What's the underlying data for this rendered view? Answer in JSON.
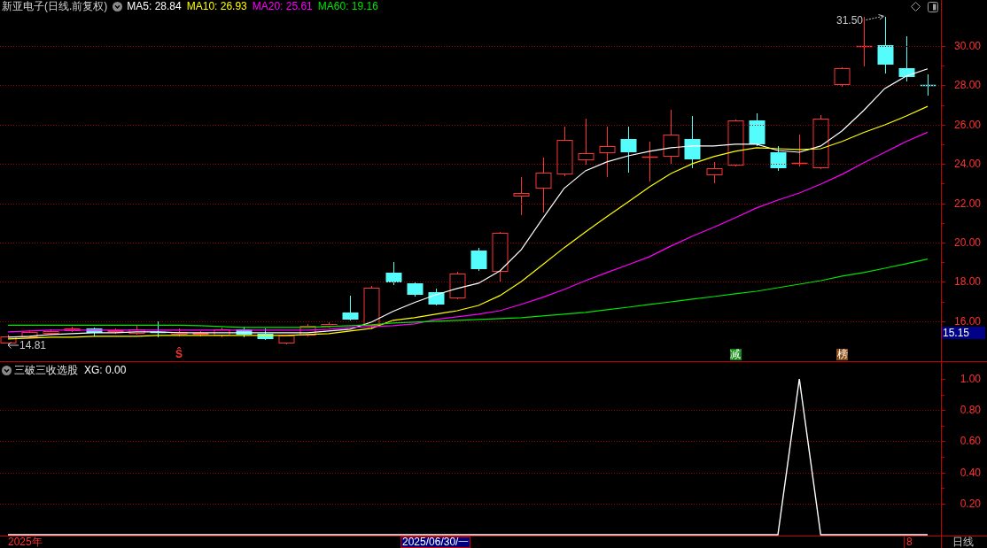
{
  "price_panel": {
    "title": "新亚电子(日线.前复权)",
    "high_marker": "31.50",
    "low_marker": "14.81",
    "signals": [
      {
        "kind": "arrow",
        "text": "Ŝ",
        "color": "#ff3232"
      },
      {
        "kind": "tag",
        "text": "减",
        "color": "#118811"
      },
      {
        "kind": "tag",
        "text": "榜",
        "color": "#8b4a12"
      }
    ],
    "price_tag": "15.15",
    "chart_data": {
      "type": "line",
      "grid": true,
      "ylim": [
        13.96,
        32.34
      ],
      "yticks": [
        {
          "value": 30,
          "label": "30.00"
        },
        {
          "value": 28,
          "label": "28.00"
        },
        {
          "value": 26,
          "label": "26.00"
        },
        {
          "value": 24,
          "label": "24.00"
        },
        {
          "value": 22,
          "label": "22.00"
        },
        {
          "value": 20,
          "label": "20.00"
        },
        {
          "value": 18,
          "label": "18.00"
        },
        {
          "value": 16,
          "label": "16.00"
        }
      ],
      "series": [
        {
          "name": "MA5: 28.84",
          "color": "#ffffff",
          "values": [
            15.18,
            15.23,
            15.32,
            15.36,
            15.41,
            15.41,
            15.45,
            15.45,
            15.41,
            15.41,
            15.41,
            15.41,
            15.41,
            15.41,
            15.41,
            15.5,
            15.59,
            15.95,
            16.49,
            16.94,
            17.34,
            17.66,
            17.93,
            18.56,
            19.64,
            21.22,
            22.75,
            23.65,
            24.1,
            24.41,
            24.64,
            24.82,
            24.91,
            24.91,
            25.0,
            25.0,
            24.68,
            24.59,
            24.91,
            25.68,
            26.71,
            27.84,
            28.47,
            28.84
          ]
        },
        {
          "name": "MA10: 26.93",
          "color": "#ffff00",
          "values": [
            15.09,
            15.14,
            15.18,
            15.18,
            15.23,
            15.23,
            15.23,
            15.27,
            15.27,
            15.27,
            15.27,
            15.27,
            15.27,
            15.27,
            15.32,
            15.36,
            15.5,
            15.63,
            16.04,
            16.17,
            16.35,
            16.53,
            16.8,
            17.3,
            18.02,
            18.87,
            19.73,
            20.54,
            21.31,
            22.07,
            22.84,
            23.51,
            24.01,
            24.37,
            24.64,
            24.82,
            24.77,
            24.73,
            24.77,
            25.14,
            25.59,
            25.99,
            26.44,
            26.93
          ]
        },
        {
          "name": "MA20: 25.61",
          "color": "#ff00ff",
          "values": [
            15.45,
            15.5,
            15.54,
            15.54,
            15.54,
            15.54,
            15.54,
            15.54,
            15.54,
            15.54,
            15.54,
            15.54,
            15.54,
            15.54,
            15.54,
            15.59,
            15.68,
            15.72,
            15.77,
            15.86,
            16.08,
            16.22,
            16.35,
            16.53,
            16.85,
            17.21,
            17.61,
            18.06,
            18.47,
            18.87,
            19.28,
            19.82,
            20.32,
            20.77,
            21.26,
            21.76,
            22.16,
            22.52,
            22.97,
            23.47,
            24.05,
            24.59,
            25.14,
            25.61
          ]
        },
        {
          "name": "MA60: 19.16",
          "color": "#00e600",
          "values": [
            15.79,
            15.79,
            15.79,
            15.79,
            15.79,
            15.79,
            15.79,
            15.79,
            15.79,
            15.77,
            15.72,
            15.68,
            15.68,
            15.68,
            15.68,
            15.72,
            15.77,
            15.81,
            15.9,
            15.95,
            15.99,
            16.04,
            16.08,
            16.13,
            16.17,
            16.26,
            16.35,
            16.44,
            16.58,
            16.71,
            16.85,
            16.98,
            17.12,
            17.25,
            17.39,
            17.52,
            17.7,
            17.88,
            18.06,
            18.29,
            18.47,
            18.69,
            18.92,
            19.16
          ]
        }
      ]
    }
  },
  "indicator_panel": {
    "name": "三破三收选股",
    "chart_data": {
      "type": "line",
      "grid": true,
      "ylim": [
        0,
        1.108
      ],
      "yticks": [
        {
          "value": 1,
          "label": "1.00"
        },
        {
          "value": 0.8,
          "label": "0.80"
        },
        {
          "value": 0.6,
          "label": "0.60"
        },
        {
          "value": 0.4,
          "label": "0.40"
        },
        {
          "value": 0.2,
          "label": "0.20"
        }
      ],
      "series": [
        {
          "name": "XG: 0.00",
          "color": "#ffffff",
          "values": [
            0,
            0,
            0,
            0,
            0,
            0,
            0,
            0,
            0,
            0,
            0,
            0,
            0,
            0,
            0,
            0,
            0,
            0,
            0,
            0,
            0,
            0,
            0,
            0,
            0,
            0,
            0,
            0,
            0,
            0,
            0,
            0,
            0,
            0,
            0,
            0,
            0,
            1,
            0,
            0,
            0,
            0,
            0,
            0
          ]
        }
      ]
    }
  },
  "time_axis": {
    "start_label": "2025年",
    "cursor_date": "2025/06/30/一",
    "right_label": "8",
    "period": "日线"
  }
}
